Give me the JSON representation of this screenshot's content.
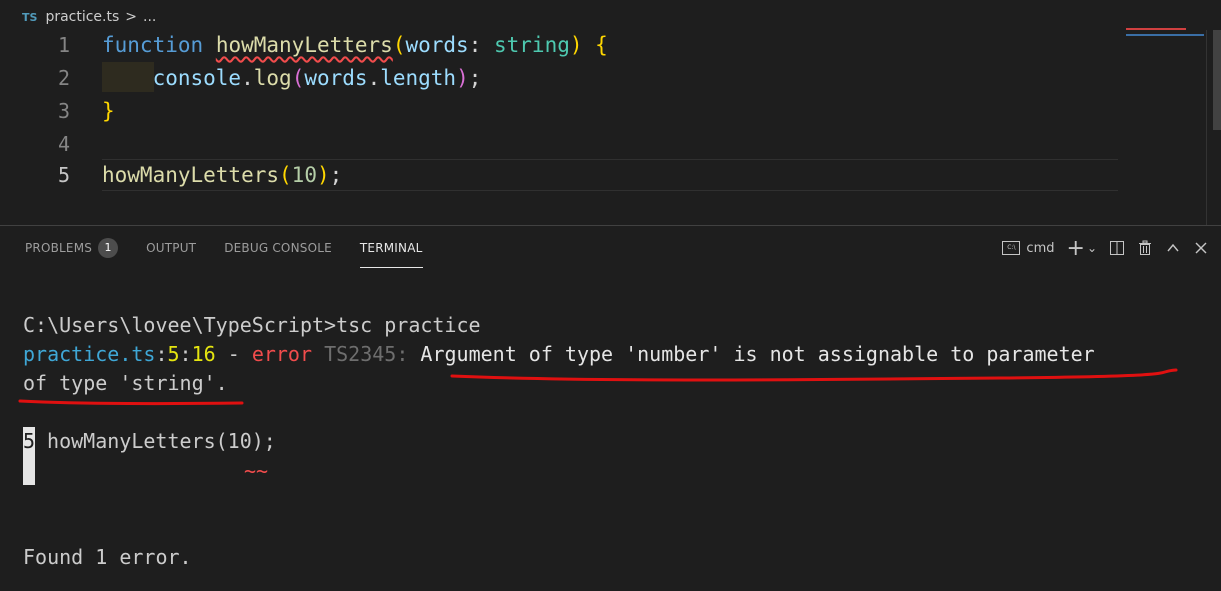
{
  "breadcrumb": {
    "lang_icon": "TS",
    "file": "practice.ts",
    "separator": ">",
    "rest": "..."
  },
  "editor": {
    "lines": [
      {
        "n": "1",
        "text": "function howManyLetters(words: string) {"
      },
      {
        "n": "2",
        "text": "    console.log(words.length);"
      },
      {
        "n": "3",
        "text": "}"
      },
      {
        "n": "4",
        "text": ""
      },
      {
        "n": "5",
        "text": "howManyLetters(10);"
      }
    ],
    "tokens": {
      "function": "function",
      "fname": "howManyLetters",
      "lparen": "(",
      "param": "words",
      "colon": ": ",
      "type": "string",
      "rparen": ")",
      "lbrace": "{",
      "console": "console",
      "dot": ".",
      "log": "log",
      "words": "words",
      "length": "length",
      "semi": ";",
      "rbrace": "}",
      "arg": "10"
    }
  },
  "panel": {
    "tabs": [
      "PROBLEMS",
      "OUTPUT",
      "DEBUG CONSOLE",
      "TERMINAL"
    ],
    "problems_count": "1",
    "shell": "cmd",
    "actions": {
      "add": "+",
      "dropdown": "⌄",
      "split": "◫",
      "trash": "🗑",
      "maximize": "︿",
      "close": "✕"
    }
  },
  "terminal": {
    "prompt": "C:\\Users\\lovee\\TypeScript>tsc practice",
    "err_file": "practice.ts",
    "err_colon1": ":",
    "err_line": "5",
    "err_colon2": ":",
    "err_col": "16",
    "err_dash": " - ",
    "err_word": "error",
    "err_code": " TS2345: ",
    "err_msg1": "Argument of type 'number' is not assignable to parameter",
    "err_msg2": "of type 'string'.",
    "src_line_no": "5",
    "src_line": " howManyLetters(10);",
    "squiggle": "~~",
    "found": "Found 1 error."
  }
}
